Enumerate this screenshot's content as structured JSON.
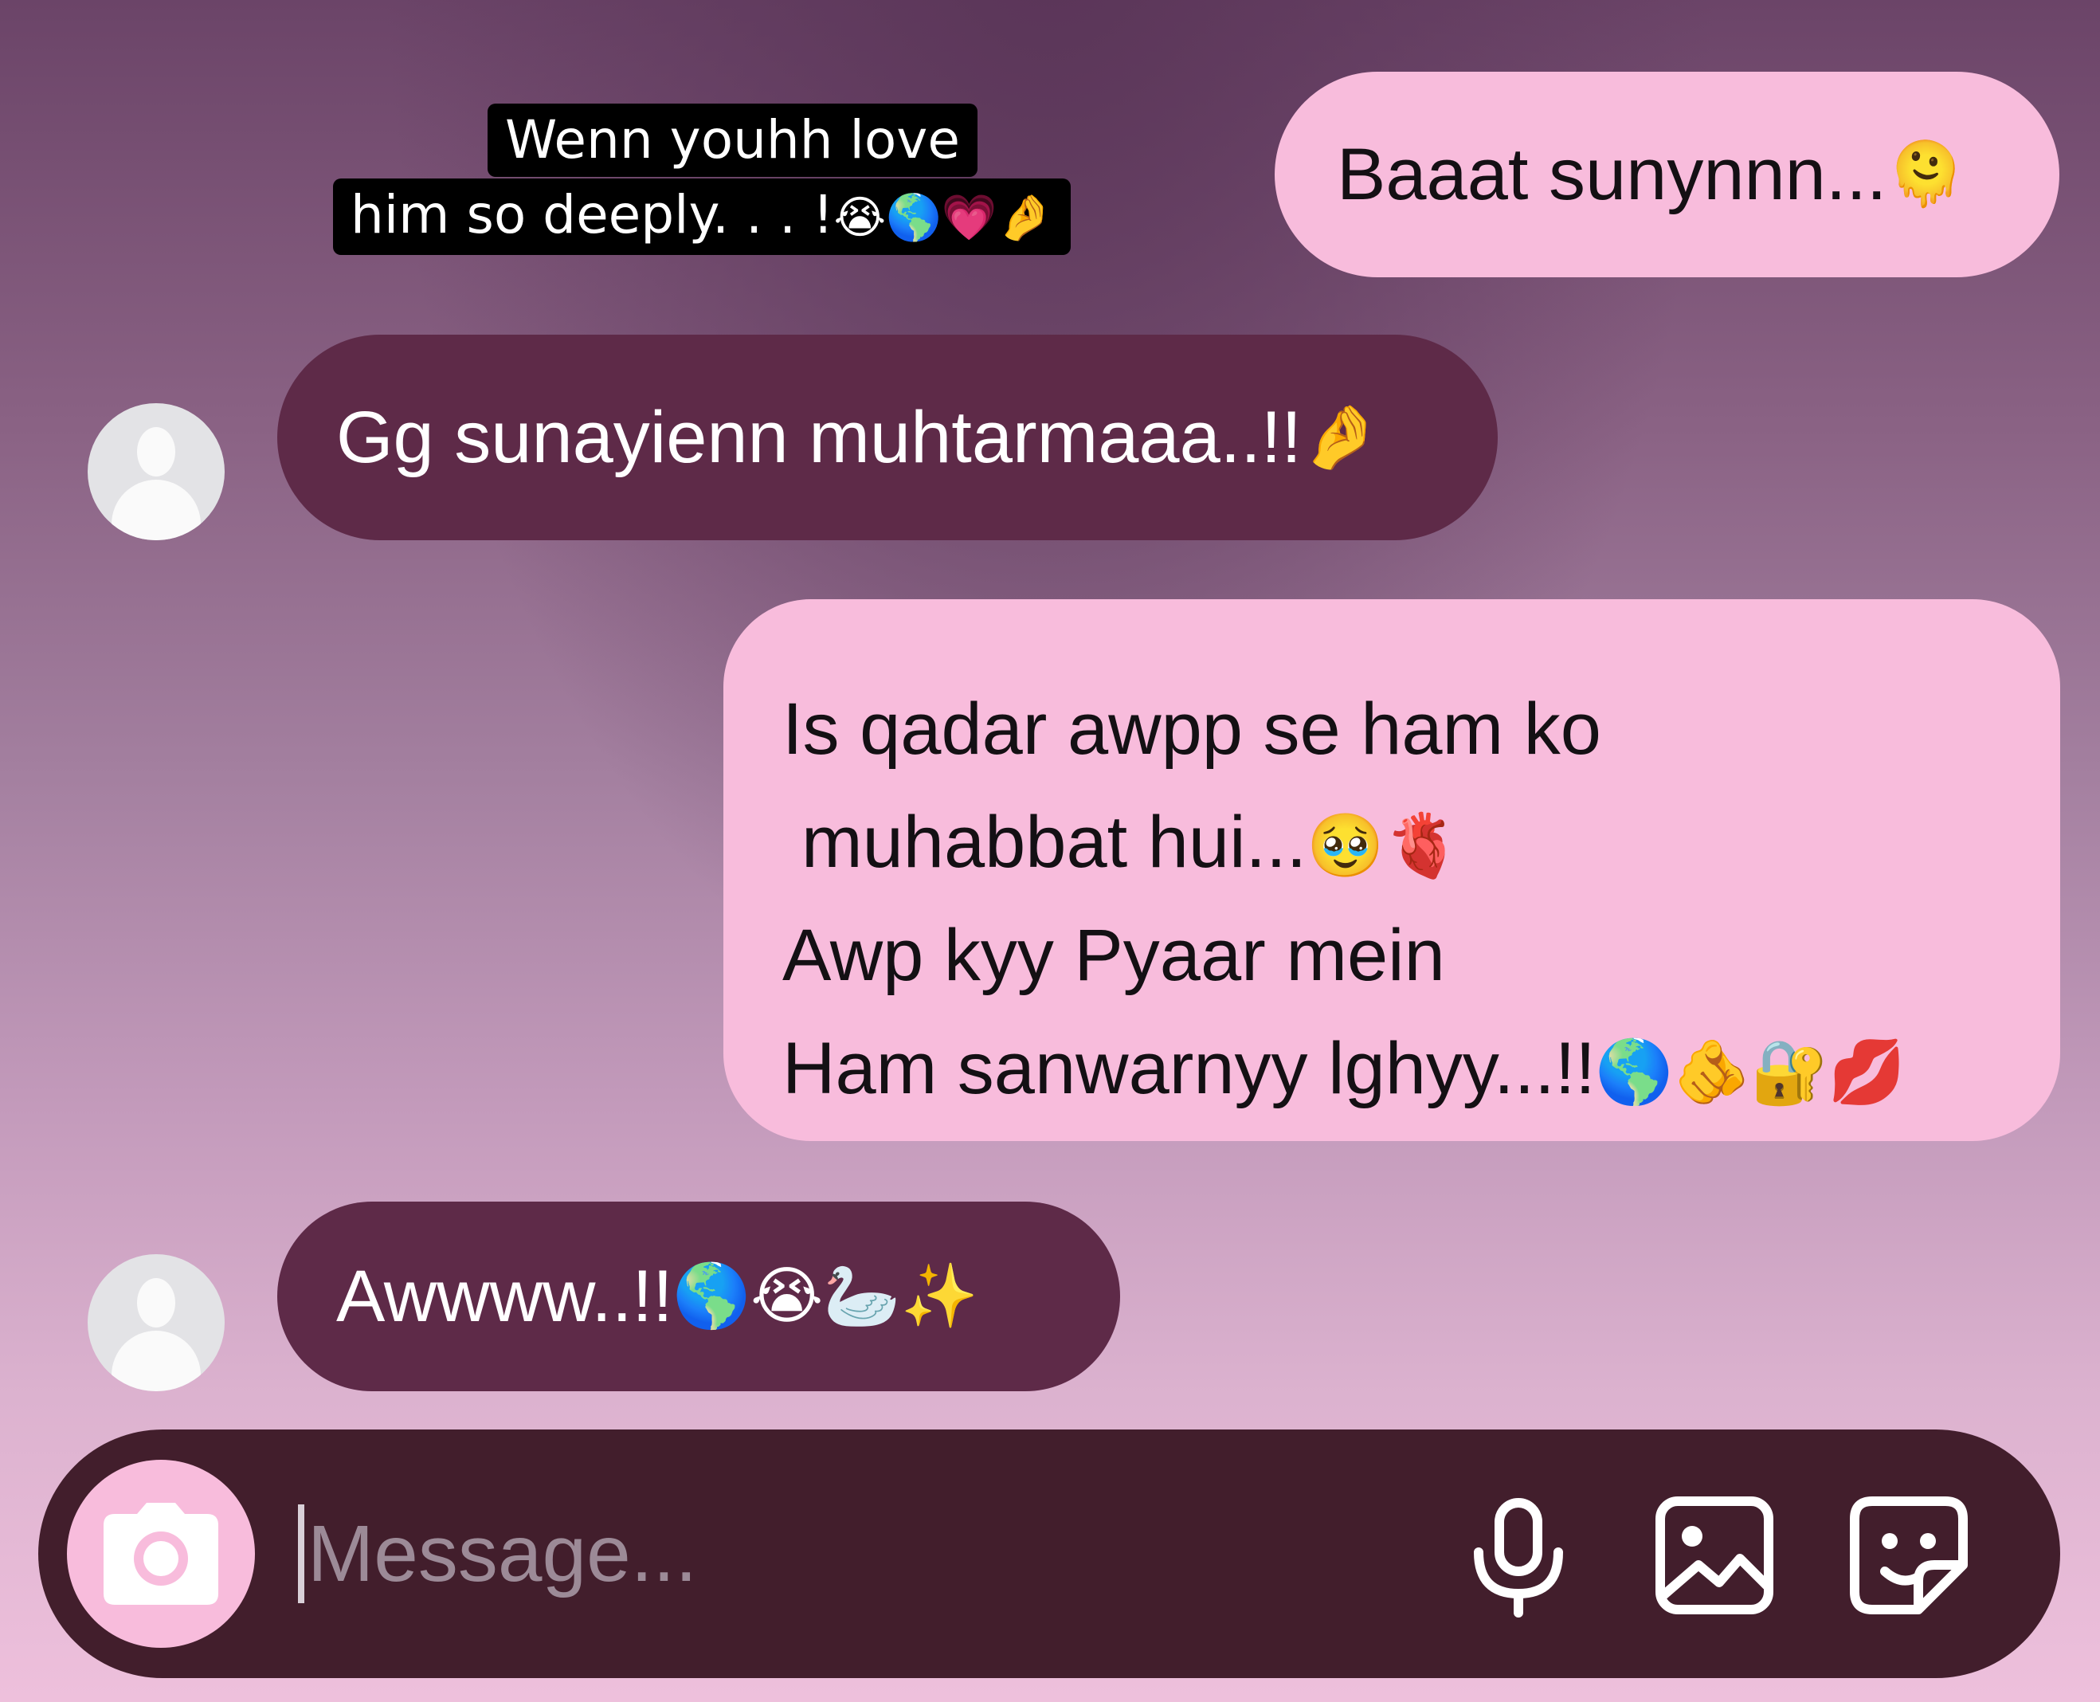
{
  "story_caption": {
    "line1": "Wenn youhh love",
    "line2_text": "him so deeply. . . !",
    "line2_emoji": "😭🌎💗🤌"
  },
  "messages": [
    {
      "side": "sent",
      "text": "Baaat sunynnn...",
      "emoji": "🫠"
    },
    {
      "side": "received",
      "text": "Gg sunayienn muhtarmaaa..!!",
      "emoji": "🤌"
    },
    {
      "side": "sent",
      "lines": [
        {
          "text": "Is qadar awpp se ham ko",
          "emoji": ""
        },
        {
          "text": "muhabbat hui...",
          "emoji": "🥹🫀"
        },
        {
          "text": "Awp kyy Pyaar mein",
          "emoji": ""
        },
        {
          "text": "Ham sanwarnyy lghyy...!!",
          "emoji": "🌎🫵🔐💋"
        }
      ]
    },
    {
      "side": "received",
      "text": "Awwww..!!",
      "emoji": "🌎😭🦢✨"
    }
  ],
  "composer": {
    "placeholder": "Message...",
    "icons": [
      "camera-icon",
      "microphone-icon",
      "gallery-icon",
      "sticker-icon"
    ]
  },
  "colors": {
    "sent_bubble": "#f8bcdc",
    "received_bubble": "#5e2a48",
    "composer_bar": "#421e2c"
  }
}
